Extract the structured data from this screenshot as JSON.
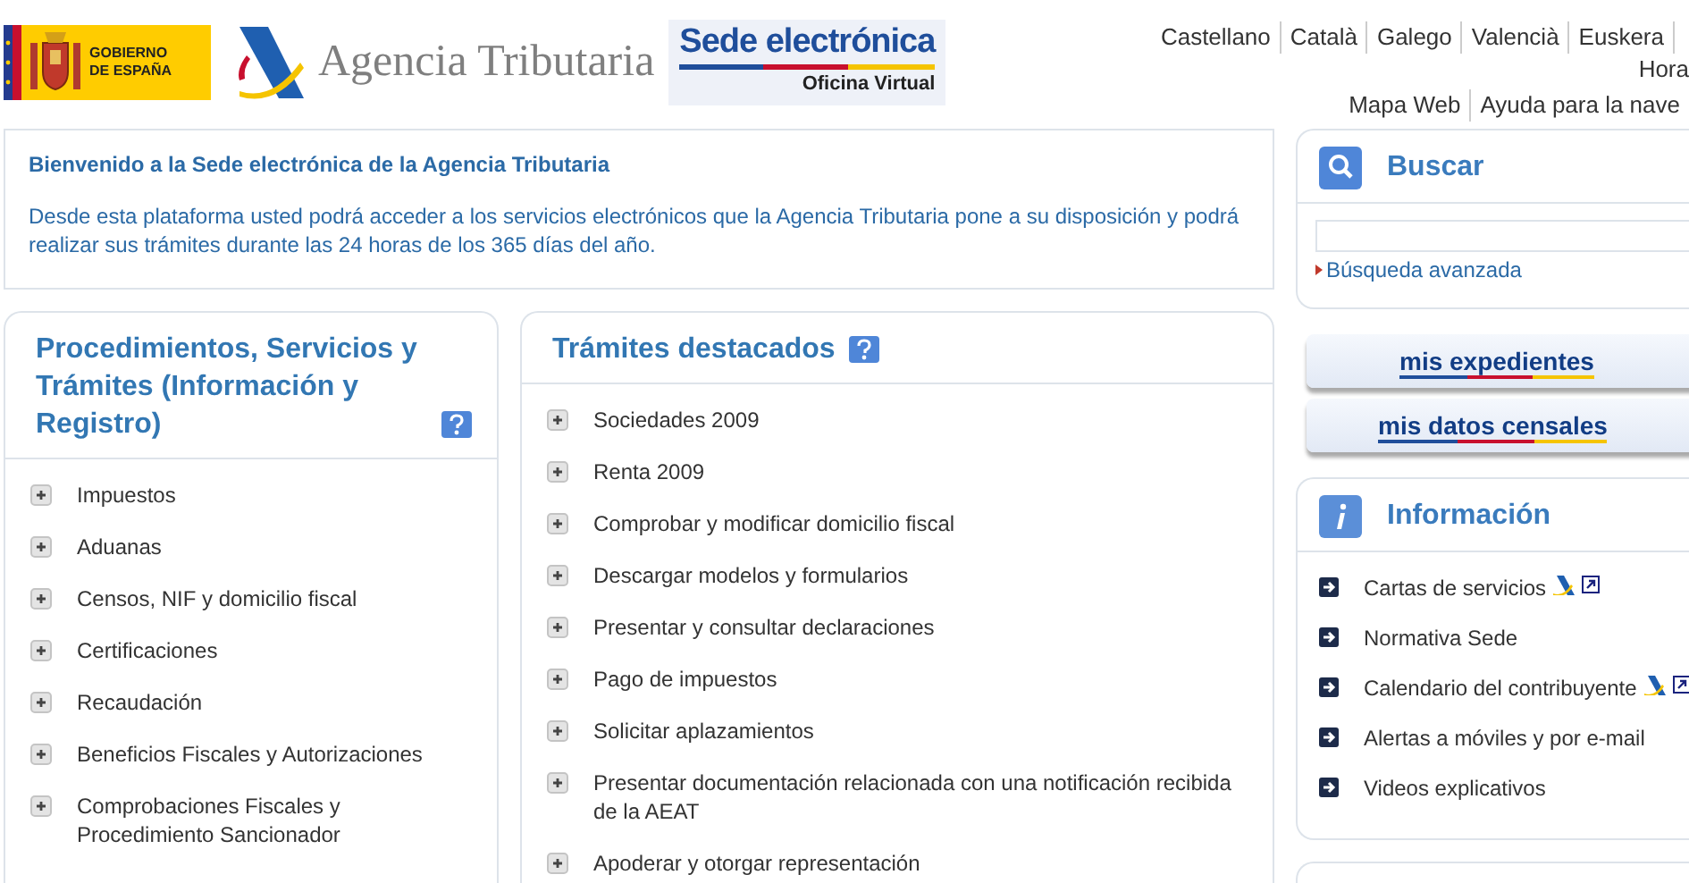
{
  "header": {
    "gov_logo": {
      "line_1": "GOBIERNO",
      "line_2": "DE ESPAÑA"
    },
    "agency_name": "Agencia Tributaria",
    "sede_logo": {
      "title": "Sede electrónica",
      "subtitle": "Oficina Virtual"
    },
    "languages": [
      "Castellano",
      "Català",
      "Galego",
      "Valencià",
      "Euskera"
    ],
    "time_link": "Hora",
    "utility_links": [
      "Mapa Web",
      "Ayuda para la nave"
    ]
  },
  "welcome": {
    "title": "Bienvenido a la Sede electrónica de la Agencia Tributaria",
    "text": "Desde esta plataforma usted podrá acceder a los servicios electrónicos que la Agencia Tributaria pone a su disposición y podrá realizar sus trámites durante las 24 horas de los 365 días del año."
  },
  "procedures": {
    "title": "Procedimientos, Servicios y Trámites (Información y Registro)",
    "items": [
      "Impuestos",
      "Aduanas",
      "Censos, NIF y domicilio fiscal",
      "Certificaciones",
      "Recaudación",
      "Beneficios Fiscales y Autorizaciones",
      "Comprobaciones Fiscales y Procedimiento Sancionador"
    ]
  },
  "featured": {
    "title": "Trámites destacados",
    "items": [
      "Sociedades 2009",
      "Renta 2009",
      "Comprobar y modificar domicilio fiscal",
      "Descargar modelos y formularios",
      "Presentar y consultar declaraciones",
      "Pago de impuestos",
      "Solicitar aplazamientos",
      "Presentar documentación relacionada con una notificación recibida de la AEAT",
      "Apoderar y otorgar representación"
    ]
  },
  "search": {
    "title": "Buscar",
    "advanced_link": "Búsqueda avanzada"
  },
  "quick_buttons": [
    "mis expedientes",
    "mis datos censales"
  ],
  "information": {
    "title": "Información",
    "items": [
      {
        "label": "Cartas de servicios",
        "kind": "external"
      },
      {
        "label": "Normativa Sede",
        "kind": "plain"
      },
      {
        "label": "Calendario del contribuyente",
        "kind": "external"
      },
      {
        "label": "Alertas a móviles y por e-mail",
        "kind": "plain"
      },
      {
        "label": "Videos explicativos",
        "kind": "plain"
      }
    ]
  }
}
